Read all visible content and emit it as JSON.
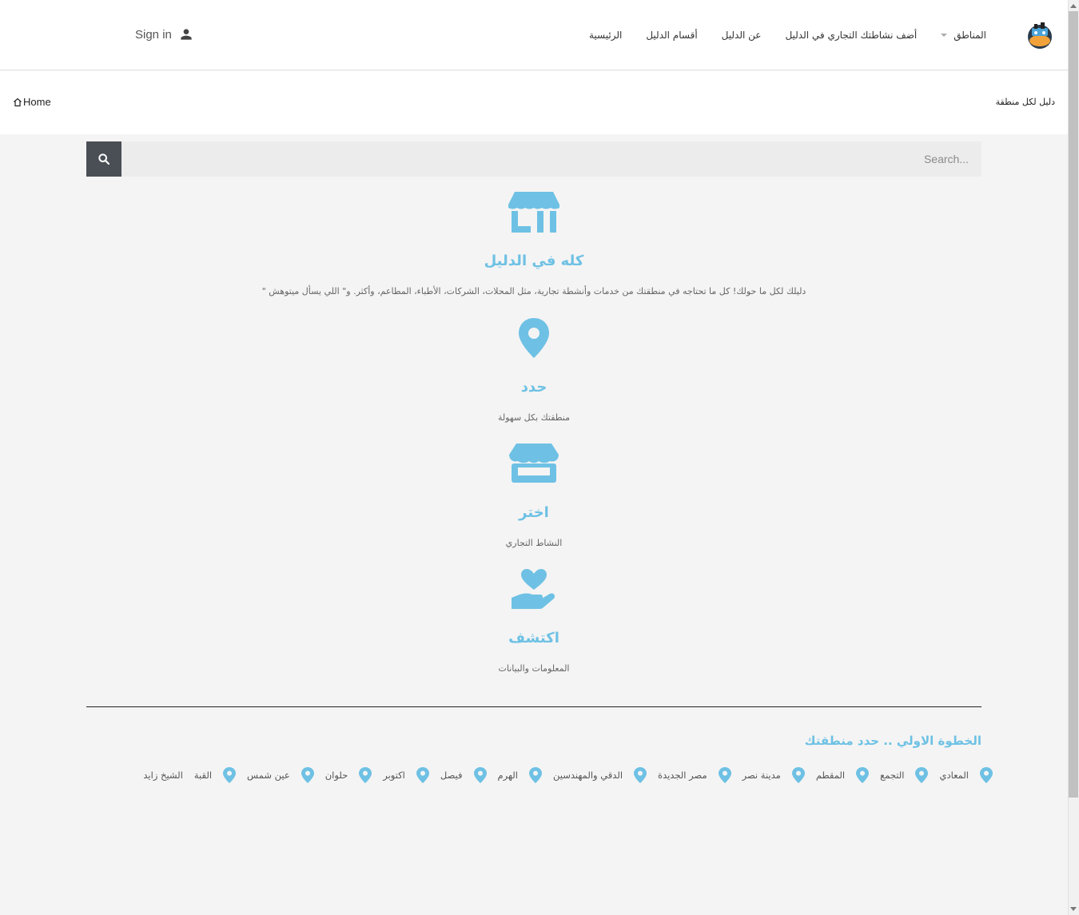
{
  "header": {
    "nav": [
      {
        "label": "الرئيسية"
      },
      {
        "label": "أقسام الدليل"
      },
      {
        "label": "عن الدليل"
      },
      {
        "label": "أضف نشاطتك التجاري في الدليل"
      },
      {
        "label": "المناطق",
        "dropdown": true
      }
    ],
    "signin_label": "Sign in",
    "logo_icon": "directory-logo-icon",
    "user_icon": "user-icon"
  },
  "breadcrumb": {
    "site_tag": "دليل لكل منطقة",
    "home_label": "Home",
    "home_icon": "home-icon"
  },
  "search": {
    "placeholder": "Search...",
    "button_icon": "search-icon"
  },
  "features": [
    {
      "icon": "storefront-icon",
      "title": "كله في الدليل",
      "desc": "دليلك لكل ما حولك! كل ما تحتاجه في منطقتك من خدمات وأنشطة تجارية، مثل المحلات، الشركات، الأطباء، المطاعم، وأكثر. و\" اللي يسأل ميتوهش \""
    },
    {
      "icon": "map-marker-icon",
      "title": "حدد",
      "desc": "منطقتك بكل سهولة"
    },
    {
      "icon": "store-icon",
      "title": "اختر",
      "desc": "النشاط التجاري"
    },
    {
      "icon": "hand-heart-icon",
      "title": "اكتشف",
      "desc": "المعلومات والبيانات"
    }
  ],
  "areas_section": {
    "title": "الخطوة الاولي .. حدد منطقتك",
    "areas": [
      "المعادي",
      "التجمع",
      "المقطم",
      "مدينة نصر",
      "مصر الجديدة",
      "الدقي والمهندسين",
      "الهرم",
      "فيصل",
      "اكتوبر",
      "حلوان",
      "عين شمس",
      "القبة",
      "الشيخ زايد"
    ]
  },
  "colors": {
    "accent": "#6ec1e4",
    "search_button": "#4a4f56",
    "background": "#f4f4f4"
  }
}
